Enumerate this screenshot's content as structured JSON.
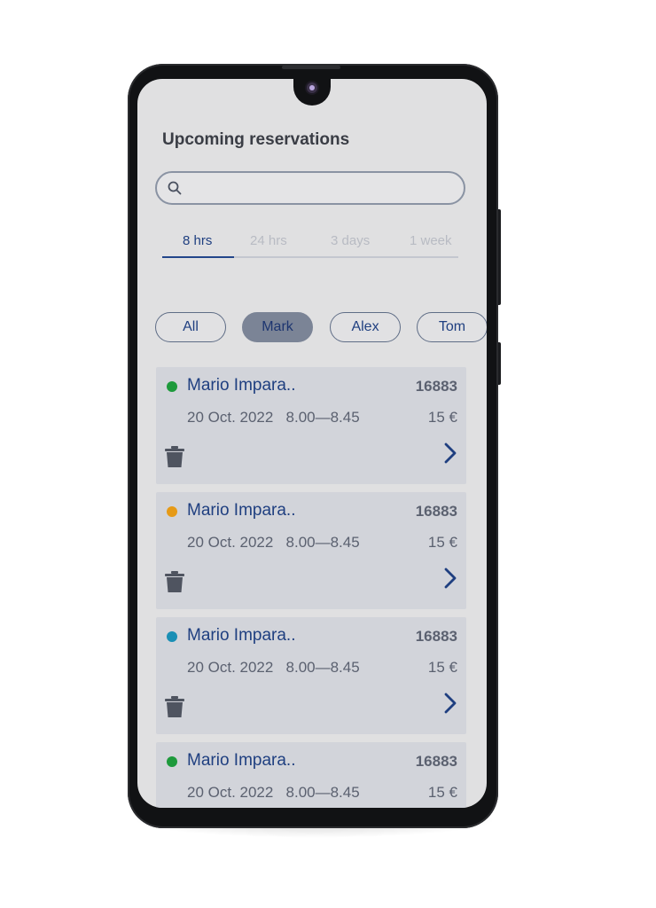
{
  "screen": {
    "title": "Upcoming reservations"
  },
  "search": {
    "value": "",
    "placeholder": ""
  },
  "time_ranges": [
    {
      "label": "8 hrs",
      "active": true
    },
    {
      "label": "24 hrs",
      "active": false
    },
    {
      "label": "3 days",
      "active": false
    },
    {
      "label": "1 week",
      "active": false
    }
  ],
  "filters": [
    {
      "label": "All",
      "active": false
    },
    {
      "label": "Mark",
      "active": true
    },
    {
      "label": "Alex",
      "active": false
    },
    {
      "label": "Tom",
      "active": false
    }
  ],
  "reservations": [
    {
      "name": "Mario Impara..",
      "id": "16883",
      "date": "20 Oct. 2022",
      "time": "8.00—8.45",
      "price": "15 €",
      "status_color": "#1e9a3c"
    },
    {
      "name": "Mario Impara..",
      "id": "16883",
      "date": "20 Oct. 2022",
      "time": "8.00—8.45",
      "price": "15 €",
      "status_color": "#e69a17"
    },
    {
      "name": "Mario Impara..",
      "id": "16883",
      "date": "20 Oct. 2022",
      "time": "8.00—8.45",
      "price": "15 €",
      "status_color": "#1a8fb5"
    },
    {
      "name": "Mario Impara..",
      "id": "16883",
      "date": "20 Oct. 2022",
      "time": "8.00—8.45",
      "price": "15 €",
      "status_color": "#1e9a3c"
    }
  ],
  "icons": {
    "search": "search-icon",
    "delete": "trash-icon",
    "open": "chevron-right-icon"
  },
  "colors": {
    "accent": "#1f3f80",
    "chip_active": "#7b8496",
    "card_bg": "#d2d4da",
    "screen_bg": "#e0e0e1"
  }
}
